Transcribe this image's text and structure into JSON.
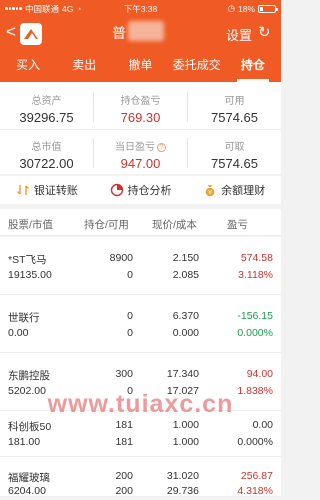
{
  "status": {
    "carrier": "中国联通",
    "network": "4G",
    "time": "下午3:38",
    "battery": "18%"
  },
  "nav": {
    "back": "<",
    "title": "普",
    "settings": "设置",
    "refresh": "↻"
  },
  "tabs": [
    {
      "label": "买入",
      "active": false
    },
    {
      "label": "卖出",
      "active": false
    },
    {
      "label": "撤单",
      "active": false
    },
    {
      "label": "委托成交",
      "active": false
    },
    {
      "label": "持仓",
      "active": true
    }
  ],
  "summary": {
    "total_assets_label": "总资产",
    "total_assets": "39296.75",
    "position_pnl_label": "持仓盈亏",
    "position_pnl": "769.30",
    "available_label": "可用",
    "available": "7574.65",
    "market_value_label": "总市值",
    "market_value": "30722.00",
    "today_pnl_label": "当日盈亏",
    "today_pnl": "947.00",
    "withdrawable_label": "可取",
    "withdrawable": "7574.65",
    "info_mark": "?"
  },
  "actions": {
    "transfer": "银证转账",
    "analysis": "持仓分析",
    "finance": "余额理财"
  },
  "table_header": {
    "name": "股票/市值",
    "qty": "持仓/可用",
    "price": "现价/成本",
    "pnl": "盈亏"
  },
  "holdings": [
    {
      "name": "*ST飞马",
      "value": "19135.00",
      "position": "8900",
      "available": "0",
      "price": "2.150",
      "cost": "2.085",
      "pnl": "574.58",
      "pct": "3.118%",
      "color": "#d0312d"
    },
    {
      "name": "世联行",
      "value": "0.00",
      "position": "0",
      "available": "0",
      "price": "6.370",
      "cost": "0.000",
      "pnl": "-156.15",
      "pct": "0.000%",
      "color": "#1a9e4b"
    },
    {
      "name": "东鹏控股",
      "value": "5202.00",
      "position": "300",
      "available": "0",
      "price": "17.340",
      "cost": "17.027",
      "pnl": "94.00",
      "pct": "1.838%",
      "color": "#d0312d"
    },
    {
      "name": "科创板50",
      "value": "181.00",
      "position": "181",
      "available": "181",
      "price": "1.000",
      "cost": "1.000",
      "pnl": "0.00",
      "pct": "0.000%",
      "color": "#333333"
    },
    {
      "name": "福耀玻璃",
      "value": "6204.00",
      "position": "200",
      "available": "200",
      "price": "31.020",
      "cost": "29.736",
      "pnl": "256.87",
      "pct": "4.318%",
      "color": "#d0312d"
    }
  ],
  "watermark": "www.tuiaxc.cn"
}
